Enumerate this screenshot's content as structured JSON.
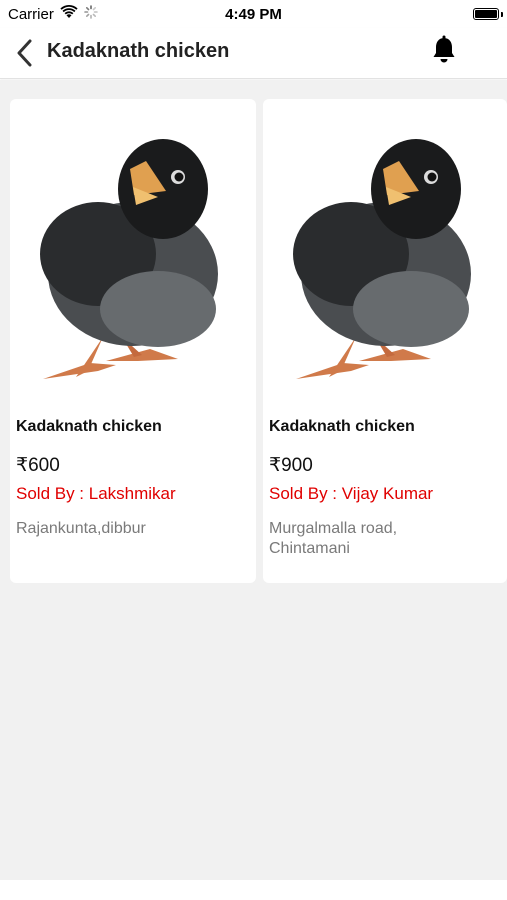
{
  "status_bar": {
    "carrier": "Carrier",
    "time": "4:49 PM",
    "icons": [
      "wifi-icon",
      "activity-spinner-icon",
      "battery-icon"
    ]
  },
  "nav": {
    "title": "Kadaknath chicken",
    "back_icon": "chevron-left-icon",
    "bell_icon": "bell-icon"
  },
  "products": [
    {
      "title": "Kadaknath chicken",
      "price": "₹600",
      "seller": "Sold By : Lakshmikar",
      "location": "Rajankunta,dibbur"
    },
    {
      "title": "Kadaknath chicken",
      "price": "₹900",
      "seller": "Sold By : Vijay Kumar",
      "location": "Murgalmalla road, Chintamani"
    }
  ],
  "colors": {
    "seller_text": "#e00000",
    "location_text": "#7a7a7a",
    "background": "#f1f1f1"
  }
}
